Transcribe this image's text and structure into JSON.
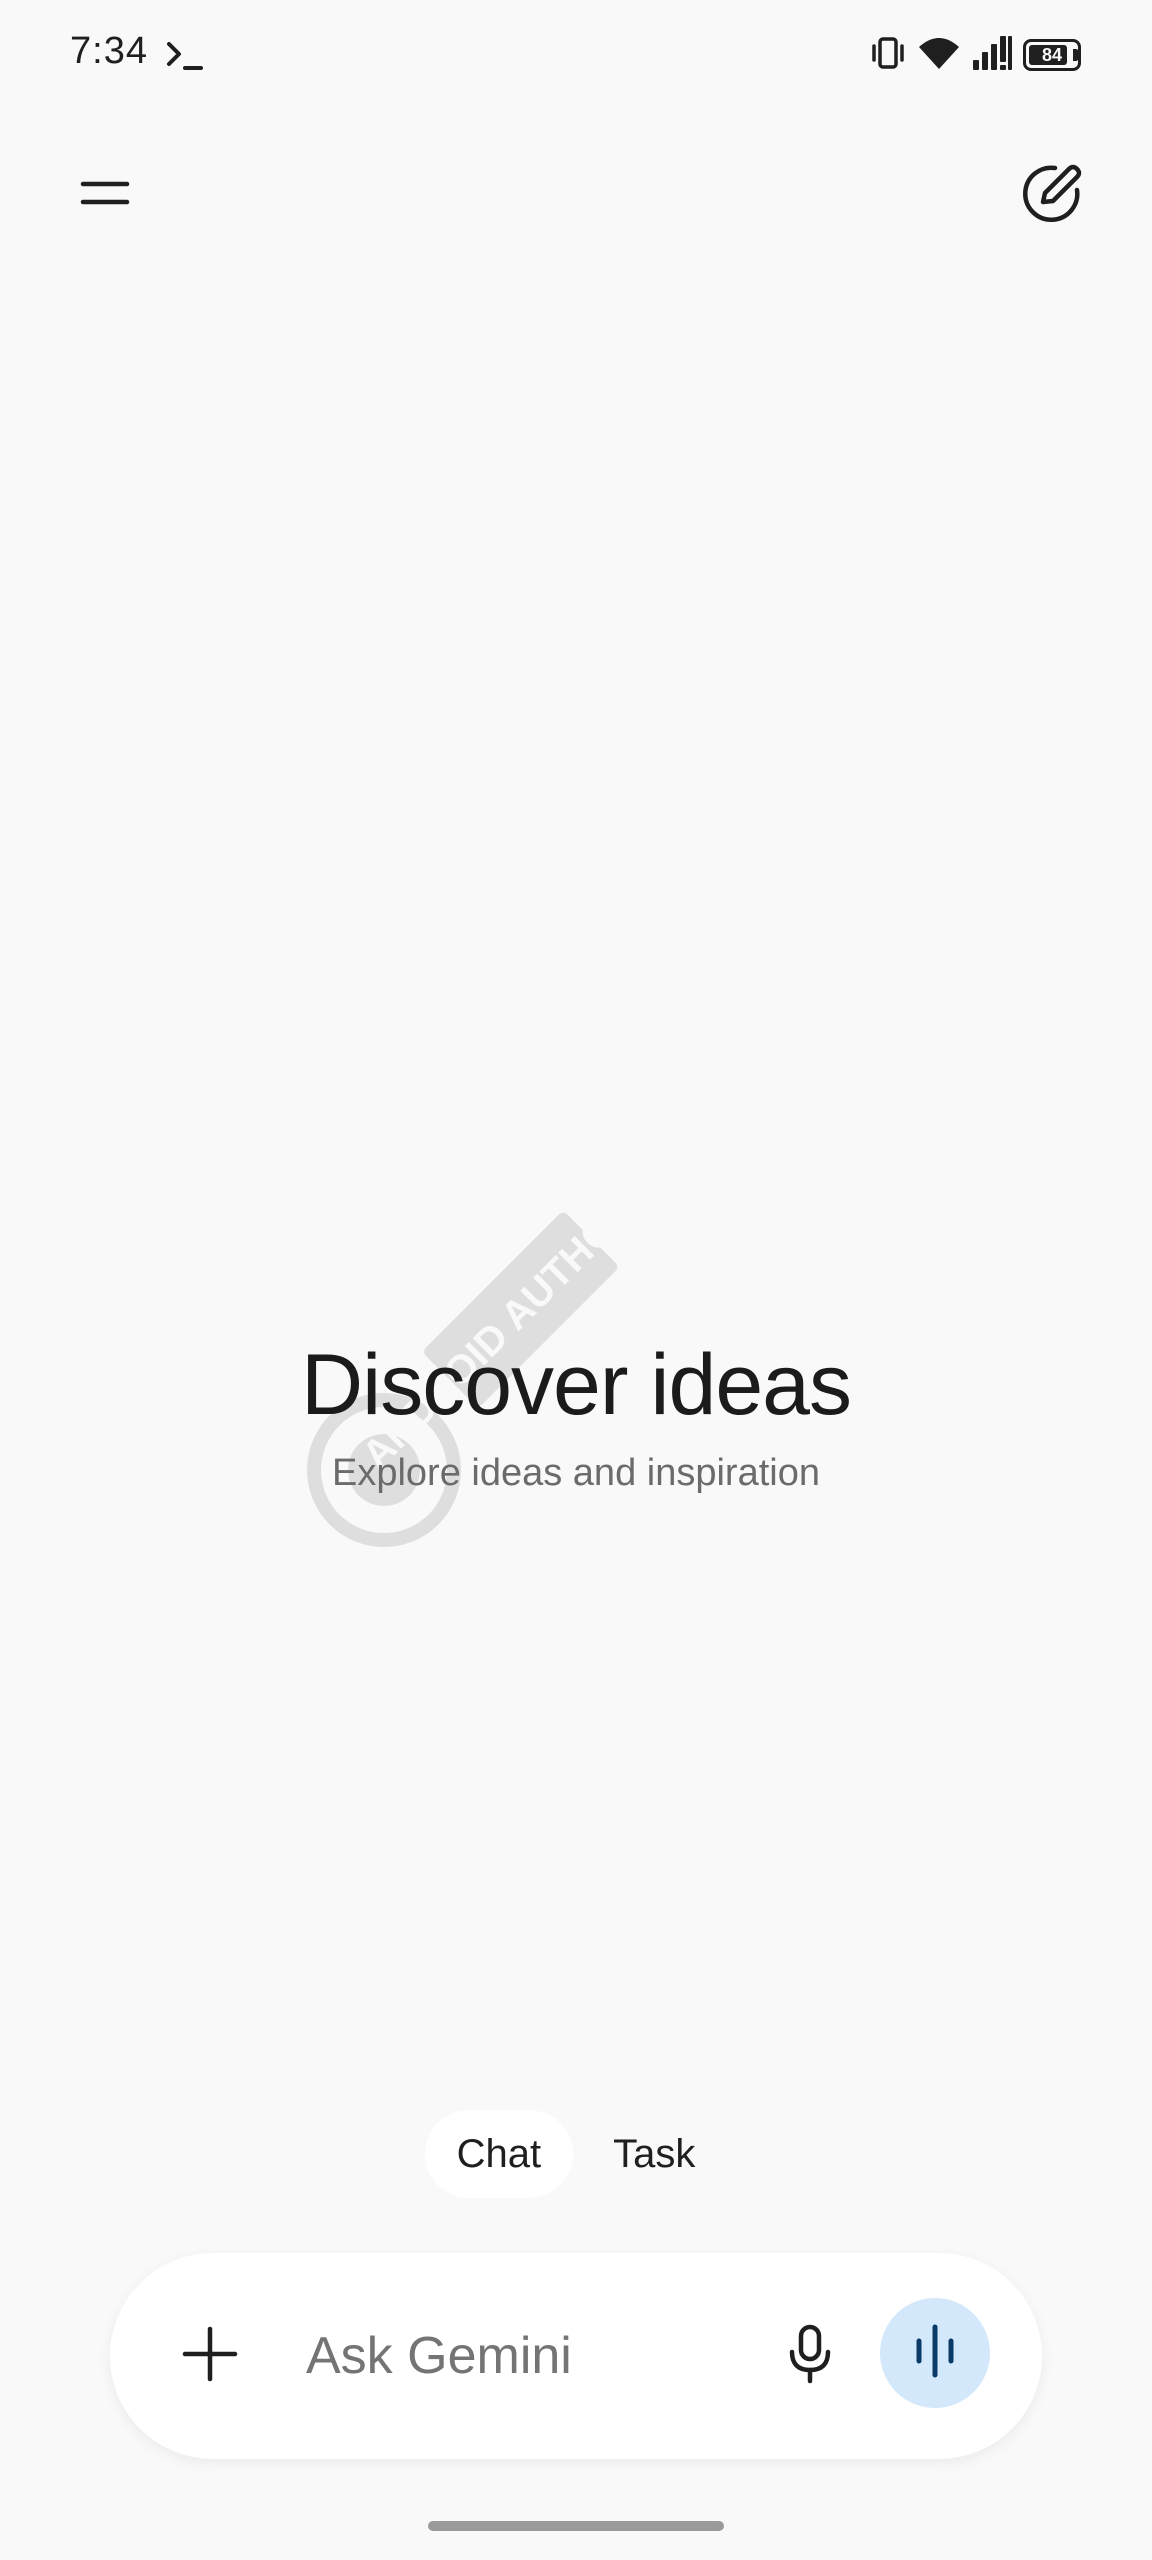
{
  "status_bar": {
    "time": "7:34",
    "battery_level": "84",
    "battery_fraction": 0.84,
    "icons": [
      "terminal-icon",
      "vibrate-icon",
      "wifi-icon",
      "signal-icon",
      "battery-icon"
    ]
  },
  "top_bar": {
    "menu_icon": "hamburger-menu-icon",
    "new_chat_icon": "edit-pencil-icon"
  },
  "main": {
    "title": "Discover ideas",
    "subtitle": "Explore ideas and inspiration",
    "watermark_text": "ANDROID AUTHORITY"
  },
  "mode_switch": {
    "tabs": [
      {
        "label": "Chat",
        "selected": true
      },
      {
        "label": "Task",
        "selected": false
      }
    ]
  },
  "input_bar": {
    "placeholder": "Ask Gemini",
    "value": "",
    "add_icon": "plus-icon",
    "mic_icon": "microphone-icon",
    "live_icon": "live-waveform-icon"
  },
  "colors": {
    "background": "#f9f9f9",
    "surface": "#ffffff",
    "live_button": "#d3e8fb",
    "text_primary": "#1f1f1f",
    "text_secondary": "#6b6b6b"
  }
}
